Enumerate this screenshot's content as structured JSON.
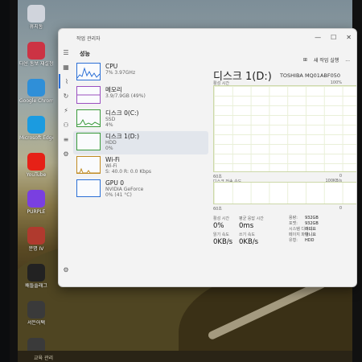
{
  "window": {
    "title": "작업 관리자",
    "section": "성능",
    "run_task_label": "새 작업 실행",
    "more": "...",
    "btn_min": "—",
    "btn_max": "☐",
    "btn_close": "✕"
  },
  "desktop_icons": [
    {
      "label": "휴지통",
      "color": "#d0d4dc"
    },
    {
      "label": "다운 통보 재설정",
      "color": "#cc3344"
    },
    {
      "label": "Google Chrome",
      "color": "#2f8fd8"
    },
    {
      "label": "Microsoft Edge",
      "color": "#1b9be0"
    },
    {
      "label": "YouTube",
      "color": "#e62117"
    },
    {
      "label": "PURPLE",
      "color": "#7a3fe0"
    },
    {
      "label": "문명 IV",
      "color": "#b03a2e"
    },
    {
      "label": "배틀플래그",
      "color": "#222222"
    },
    {
      "label": "서든어택",
      "color": "#3a3a3a"
    },
    {
      "label": "서든어택",
      "color": "#3a3a3a"
    }
  ],
  "perf_items": [
    {
      "name": "CPU",
      "line1": "7% 3.97GHz",
      "line2": "",
      "color": "#2b6fd6"
    },
    {
      "name": "메모리",
      "line1": "3.9/7.9GB (49%)",
      "line2": "",
      "color": "#9b4fc0"
    },
    {
      "name": "디스크 0(C:)",
      "line1": "SSD",
      "line2": "4%",
      "color": "#3a9a3a"
    },
    {
      "name": "디스크 1(D:)",
      "line1": "HDD",
      "line2": "0%",
      "color": "#3a9a3a"
    },
    {
      "name": "Wi-Fi",
      "line1": "Wi-Fi",
      "line2": "S: 40.0 R: 0.0 Kbps",
      "color": "#c08a20"
    },
    {
      "name": "GPU 0",
      "line1": "NVIDIA GeForce",
      "line2": "0% (41 °C)",
      "color": "#2b6fd6"
    }
  ],
  "detail": {
    "title": "디스크 1(D:)",
    "model": "TOSHIBA MQ01ABF050",
    "graph_top_left": "활성 시간",
    "graph_top_right": "100%",
    "graph_bottom_left": "60초",
    "graph_bottom_right": "0",
    "graph2_top_left": "디스크 전송 속도",
    "graph2_top_right": "100KB/s",
    "graph2_bottom_left": "60초",
    "graph2_bottom_right": "0",
    "active_time_label": "활성 시간",
    "active_time_value": "0%",
    "avg_response_label": "평균 응답 시간",
    "avg_response_value": "0ms",
    "read_label": "읽기 속도",
    "read_value": "0KB/s",
    "write_label": "쓰기 속도",
    "write_value": "0KB/s",
    "props": [
      {
        "k": "용량:",
        "v": "932GB"
      },
      {
        "k": "포맷:",
        "v": "932GB"
      },
      {
        "k": "시스템 디스크:",
        "v": "아니요"
      },
      {
        "k": "페이지 파일:",
        "v": "아니요"
      },
      {
        "k": "유형:",
        "v": "HDD"
      }
    ]
  },
  "taskbar": {
    "peek_text": "교육  관리"
  }
}
